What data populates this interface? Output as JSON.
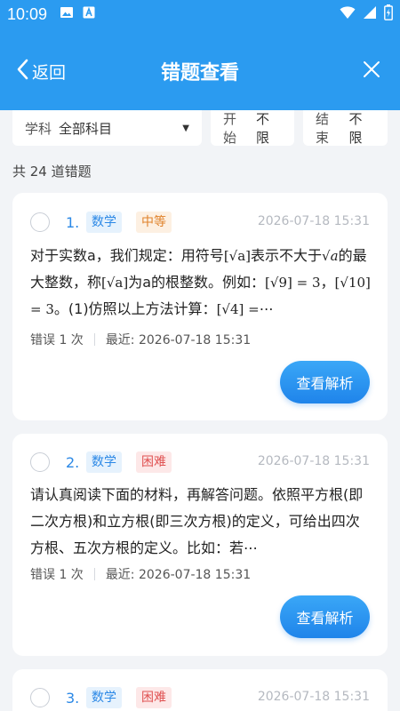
{
  "status": {
    "time": "10:09"
  },
  "header": {
    "back_label": "返回",
    "title": "错题查看"
  },
  "filters": {
    "subject_label": "学科",
    "subject_value": "全部科目",
    "start_label": "开始",
    "start_value": "不限",
    "end_label": "结束",
    "end_value": "不限"
  },
  "total": "共 24 道错题",
  "cards": [
    {
      "num": "1.",
      "subject": "数学",
      "difficulty": "中等",
      "date": "2026-07-18 15:31",
      "q_parts": [
        "对于实数a，我们规定：用符号",
        "[√a]",
        "表示不大于",
        "√a",
        "的最大整数，称",
        "[√a]",
        "为a的根整数。例如：",
        "[√9] = 3",
        "，",
        "[√10] = 3",
        "。(1)仿照以上方法计算：",
        "[√4] =",
        "⋯"
      ],
      "errors": "错误 1 次",
      "recent": "最近: 2026-07-18 15:31",
      "btn": "查看解析"
    },
    {
      "num": "2.",
      "subject": "数学",
      "difficulty": "困难",
      "date": "2026-07-18 15:31",
      "question": "请认真阅读下面的材料，再解答问题。依照平方根(即二次方根)和立方根(即三次方根)的定义，可给出四次方根、五次方根的定义。比如：若⋯",
      "errors": "错误 1 次",
      "recent": "最近: 2026-07-18 15:31",
      "btn": "查看解析"
    },
    {
      "num": "3.",
      "subject": "数学",
      "difficulty": "困难",
      "date": "2026-07-18 15:31"
    }
  ]
}
